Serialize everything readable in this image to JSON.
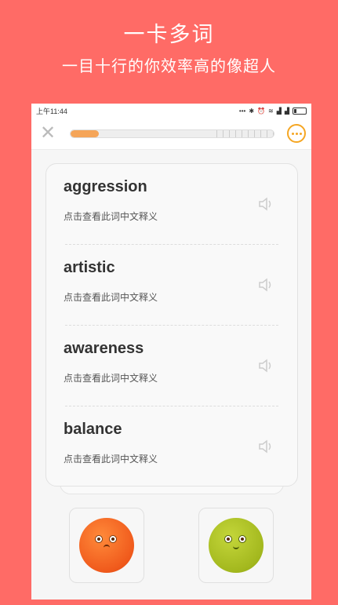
{
  "promo": {
    "title": "一卡多词",
    "subtitle": "一目十行的你效率高的像超人"
  },
  "status_bar": {
    "time": "上午11:44",
    "icons": [
      "dots-icon",
      "bluetooth-icon",
      "alarm-icon",
      "wifi-icon",
      "signal-icon",
      "signal-icon",
      "battery-icon"
    ]
  },
  "header": {
    "close_icon": "close-icon",
    "progress": 0.14,
    "more_icon": "more-icon"
  },
  "words": [
    {
      "word": "aggression",
      "hint": "点击查看此词中文释义"
    },
    {
      "word": "artistic",
      "hint": "点击查看此词中文释义"
    },
    {
      "word": "awareness",
      "hint": "点击查看此词中文释义"
    },
    {
      "word": "balance",
      "hint": "点击查看此词中文释义"
    }
  ],
  "buttons": {
    "left": {
      "icon": "orange-face-icon",
      "color": "#f05a1c"
    },
    "right": {
      "icon": "green-face-icon",
      "color": "#a3b81e"
    }
  },
  "colors": {
    "background": "#ff6b66",
    "accent": "#f5a623",
    "progress": "#f5a558"
  }
}
